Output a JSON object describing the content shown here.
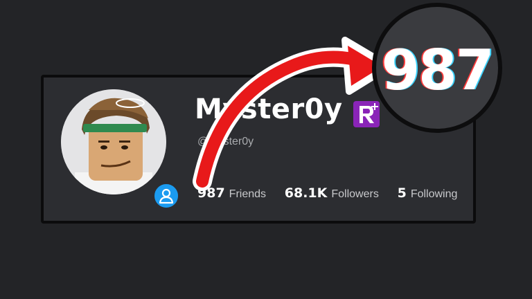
{
  "profile": {
    "display_name": "Myster0y",
    "username": "@Myster0y",
    "premium_icon": "premium-r-icon",
    "status_icon": "online-person-icon",
    "stats": [
      {
        "value": "987",
        "label": "Friends"
      },
      {
        "value": "68.1K",
        "label": "Followers"
      },
      {
        "value": "5",
        "label": "Following"
      }
    ]
  },
  "highlight": {
    "zoomed_value": "987",
    "arrow_color": "#e8191a"
  },
  "colors": {
    "background": "#232427",
    "card": "#2c2d31",
    "premium": "#8a24b8",
    "online": "#1b9bf0"
  }
}
